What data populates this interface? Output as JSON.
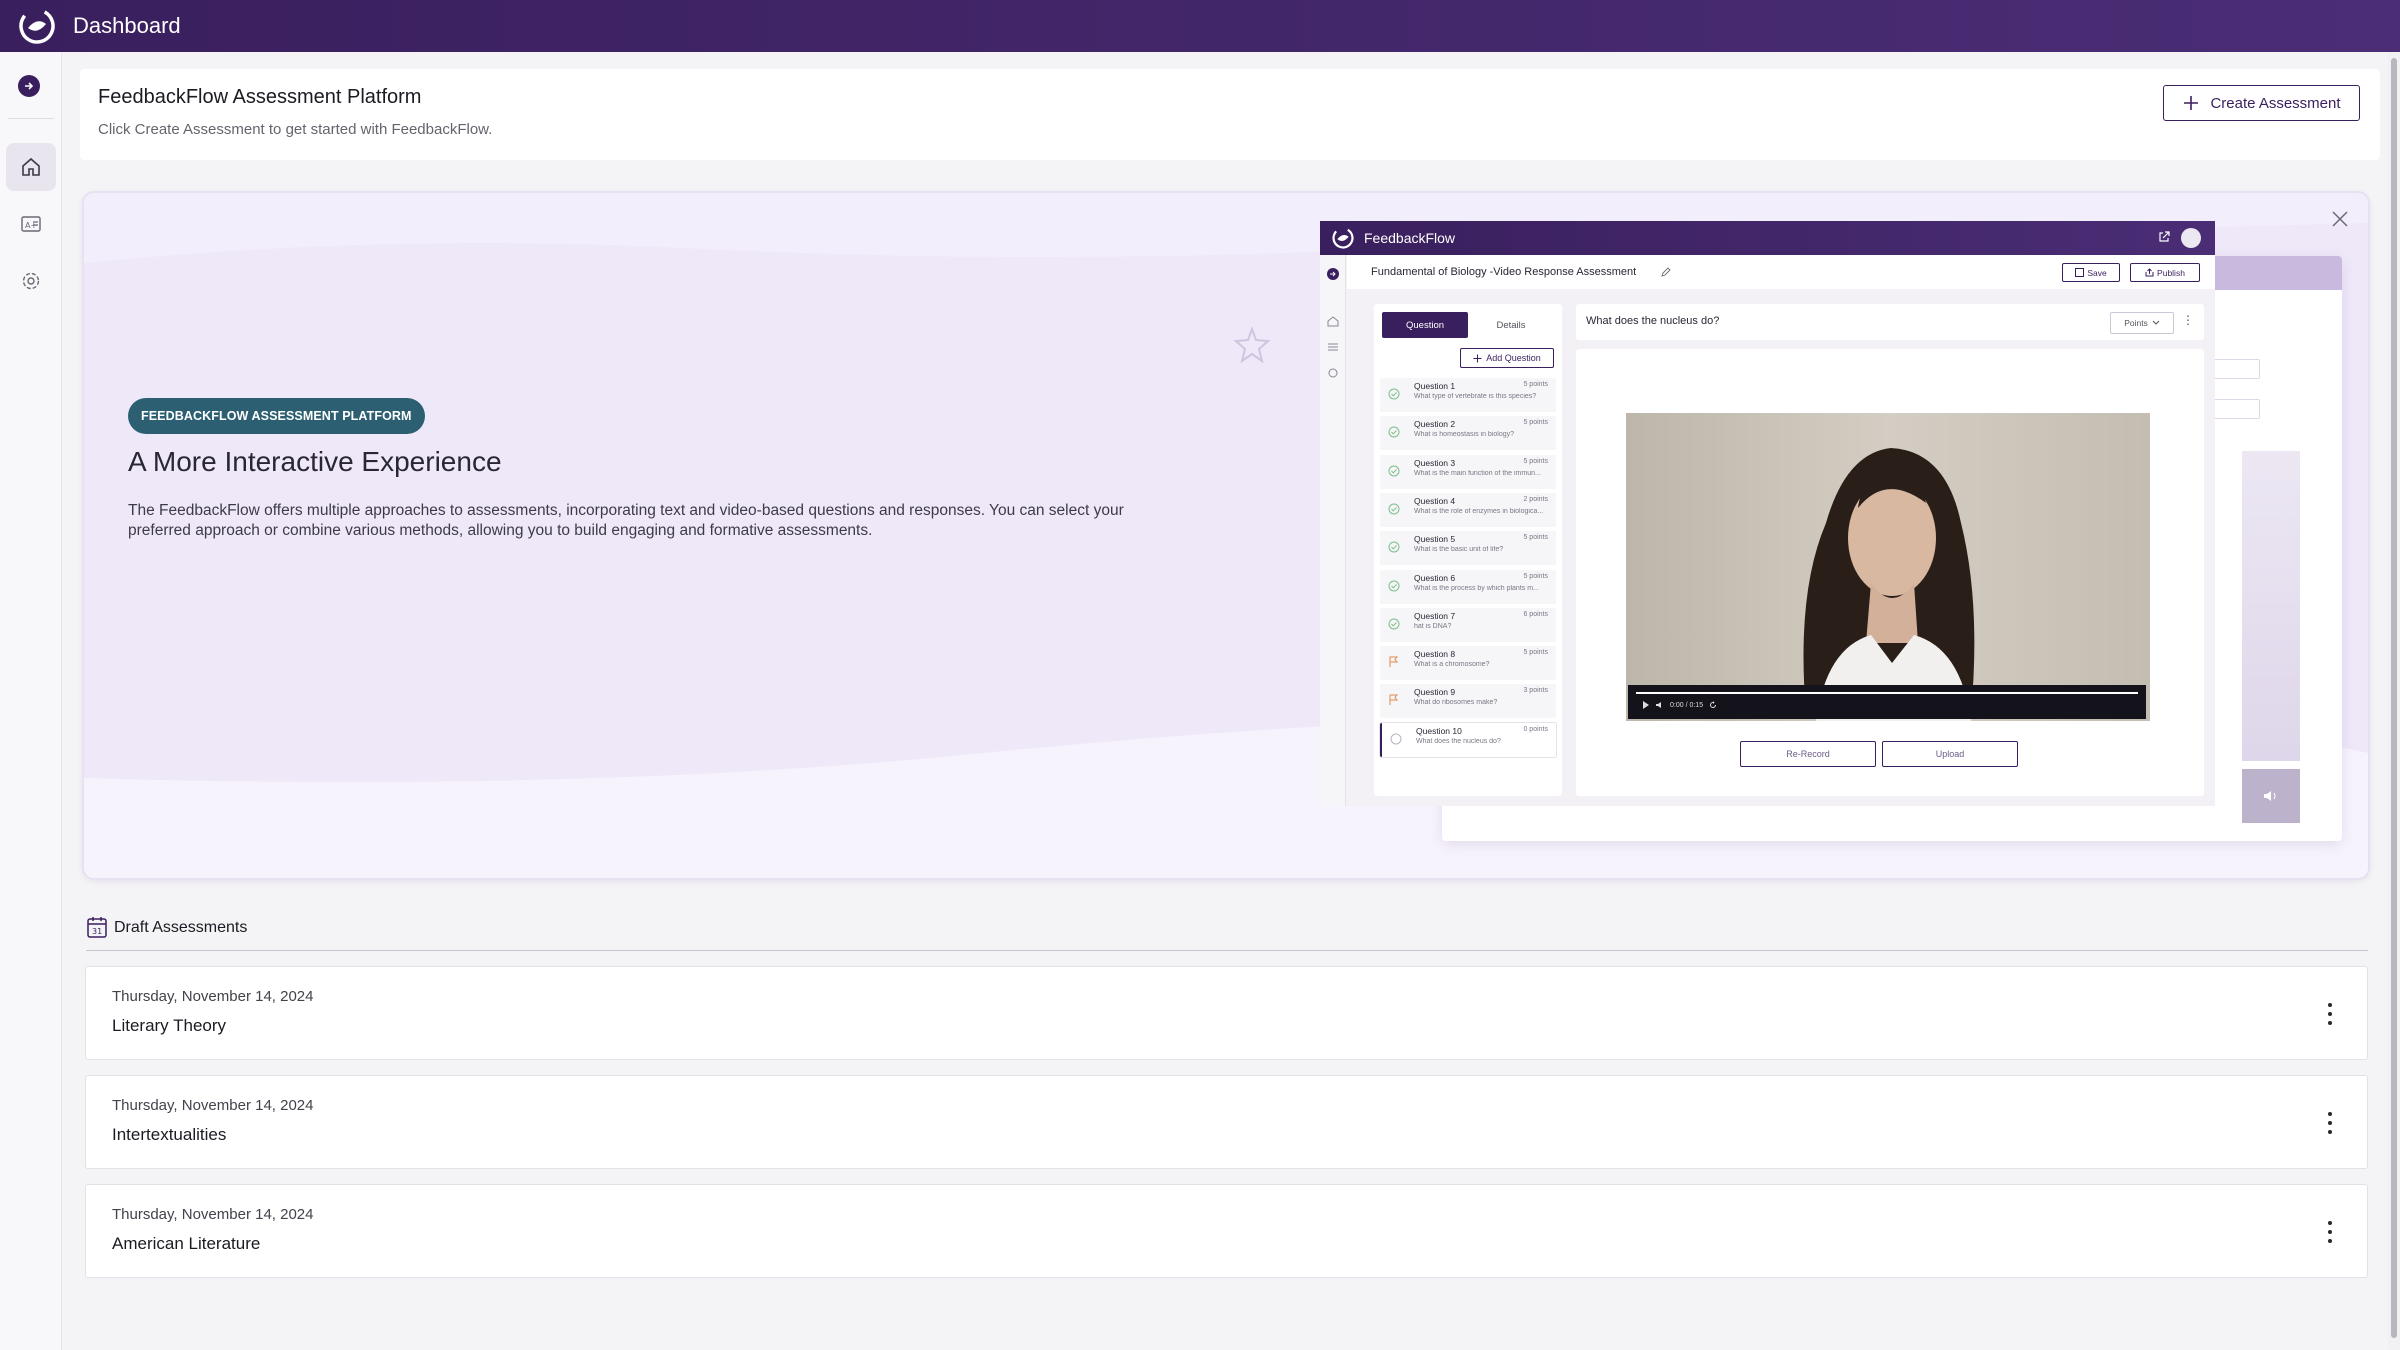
{
  "app": {
    "title": "Dashboard"
  },
  "sidebar": {
    "items": [
      {
        "name": "home"
      },
      {
        "name": "grades"
      },
      {
        "name": "settings"
      }
    ]
  },
  "header": {
    "title": "FeedbackFlow Assessment Platform",
    "subtitle": "Click Create Assessment to get started with FeedbackFlow.",
    "create_label": "Create Assessment"
  },
  "hero": {
    "badge": "FEEDBACKFLOW ASSESSMENT PLATFORM",
    "heading": "A More Interactive Experience",
    "body": "The FeedbackFlow offers multiple approaches to assessments, incorporating text and video-based questions and responses. You can select your preferred approach or combine various methods, allowing you to build engaging and formative assessments.",
    "mockup": {
      "app_title": "FeedbackFlow",
      "assessment_title": "Fundamental of Biology -Video Response Assessment",
      "save_label": "Save",
      "publish_label": "Publish",
      "tabs": [
        "Question",
        "Details"
      ],
      "add_question_label": "Add Question",
      "questions": [
        {
          "title": "Question 1",
          "points": "5 points",
          "text": "What type of vertebrate is this species?",
          "status": "done"
        },
        {
          "title": "Question 2",
          "points": "5 points",
          "text": "What is homeostasis in biology?",
          "status": "done"
        },
        {
          "title": "Question 3",
          "points": "5 points",
          "text": "What is the main function of the immun...",
          "status": "done"
        },
        {
          "title": "Question 4",
          "points": "2 points",
          "text": "What is the role of enzymes in biologica...",
          "status": "done"
        },
        {
          "title": "Question 5",
          "points": "5 points",
          "text": "What is the basic unit of life?",
          "status": "done"
        },
        {
          "title": "Question 6",
          "points": "5 points",
          "text": "What is the process by which plants m...",
          "status": "done"
        },
        {
          "title": "Question 7",
          "points": "6 points",
          "text": "hat is DNA?",
          "status": "done"
        },
        {
          "title": "Question 8",
          "points": "5 points",
          "text": "What is a chromosome?",
          "status": "flag"
        },
        {
          "title": "Question 9",
          "points": "3 points",
          "text": "What do ribosomes make?",
          "status": "flag"
        },
        {
          "title": "Question 10",
          "points": "0 points",
          "text": "What does the nucleus do?",
          "status": "empty"
        }
      ],
      "current_question": "What does the nucleus do?",
      "points_select": "Points",
      "video_time": "0:00 / 0:15",
      "rerecord_label": "Re-Record",
      "upload_label": "Upload"
    }
  },
  "drafts": {
    "title": "Draft Assessments",
    "calendar_day": "31",
    "items": [
      {
        "date": "Thursday, November 14, 2024",
        "name": "Literary Theory"
      },
      {
        "date": "Thursday, November 14, 2024",
        "name": "Intertextualities"
      },
      {
        "date": "Thursday, November 14, 2024",
        "name": "American Literature"
      }
    ]
  },
  "colors": {
    "brand": "#3a1f5e",
    "badge": "#2d5f73",
    "hero_bg": "#f3eefb"
  }
}
